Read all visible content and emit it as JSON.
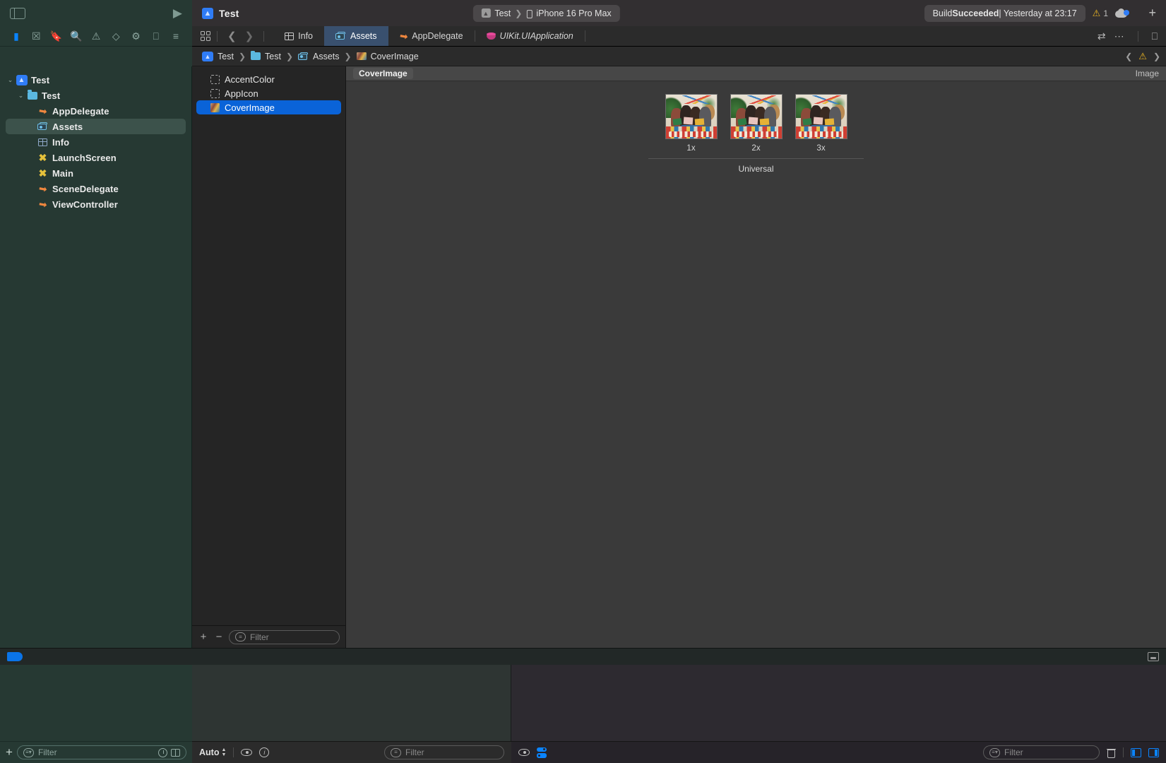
{
  "toolbar": {
    "sidebar_toggle_icon": "sidebar-toggle-icon",
    "run_icon": "play-icon",
    "project_name": "Test",
    "scheme": "Test",
    "destination": "iPhone 16 Pro Max",
    "build_status_prefix": "Build ",
    "build_status_strong": "Succeeded",
    "build_status_suffix": " | Yesterday at 23:17",
    "warning_count": "1",
    "add_icon": "plus-icon",
    "cloud_icon": "cloud-icon"
  },
  "navigator_icons": [
    {
      "name": "folder-icon",
      "glyph": "▮",
      "active": true
    },
    {
      "name": "source-control-icon",
      "glyph": "☒",
      "active": false
    },
    {
      "name": "bookmarks-icon",
      "glyph": "⚑",
      "active": false
    },
    {
      "name": "search-icon",
      "glyph": "⌕",
      "active": false
    },
    {
      "name": "issue-navigator-icon",
      "glyph": "⚠",
      "active": false
    },
    {
      "name": "test-navigator-icon",
      "glyph": "◇",
      "active": false
    },
    {
      "name": "debug-navigator-icon",
      "glyph": "☈",
      "active": false
    },
    {
      "name": "breakpoint-navigator-icon",
      "glyph": "⎕",
      "active": false
    },
    {
      "name": "report-navigator-icon",
      "glyph": "≡",
      "active": false
    }
  ],
  "tabbar": {
    "grid_icon": "grid-icon",
    "back_icon": "chevron-left-icon",
    "forward_icon": "chevron-right-icon",
    "tabs": [
      {
        "label": "Info",
        "icon": "plist-table-icon",
        "selected": false
      },
      {
        "label": "Assets",
        "icon": "assets-catalog-icon",
        "selected": true
      },
      {
        "label": "AppDelegate",
        "icon": "swift-file-icon",
        "selected": false
      },
      {
        "label": "UIKit.UIApplication",
        "icon": "uikit-framework-icon",
        "selected": false,
        "italic": true
      }
    ],
    "right_icons": [
      {
        "name": "swap-editors-icon",
        "glyph": "⇄"
      },
      {
        "name": "more-options-icon",
        "glyph": "⊙"
      },
      {
        "name": "add-editor-icon",
        "glyph": "⬚"
      }
    ]
  },
  "jumpbar": {
    "crumbs": [
      {
        "label": "Test",
        "icon": "project-icon"
      },
      {
        "label": "Test",
        "icon": "folder-icon"
      },
      {
        "label": "Assets",
        "icon": "assets-catalog-icon"
      },
      {
        "label": "CoverImage",
        "icon": "image-thumbnail-icon"
      }
    ],
    "separator": "❯",
    "prev_issue_icon": "chevron-left-icon",
    "warning_icon": "warning-triangle-icon",
    "next_issue_icon": "chevron-right-icon"
  },
  "project_tree": [
    {
      "label": "Test",
      "icon": "project-icon",
      "depth": 0,
      "twisty": "⌄",
      "selected": false
    },
    {
      "label": "Test",
      "icon": "folder-icon",
      "depth": 1,
      "twisty": "⌄",
      "selected": false
    },
    {
      "label": "AppDelegate",
      "icon": "swift-file-icon",
      "depth": 2,
      "twisty": "",
      "selected": false
    },
    {
      "label": "Assets",
      "icon": "assets-catalog-icon",
      "depth": 2,
      "twisty": "",
      "selected": true
    },
    {
      "label": "Info",
      "icon": "plist-file-icon",
      "depth": 2,
      "twisty": "",
      "selected": false
    },
    {
      "label": "LaunchScreen",
      "icon": "storyboard-icon",
      "depth": 2,
      "twisty": "",
      "selected": false
    },
    {
      "label": "Main",
      "icon": "storyboard-icon",
      "depth": 2,
      "twisty": "",
      "selected": false
    },
    {
      "label": "SceneDelegate",
      "icon": "swift-file-icon",
      "depth": 2,
      "twisty": "",
      "selected": false
    },
    {
      "label": "ViewController",
      "icon": "swift-file-icon",
      "depth": 2,
      "twisty": "",
      "selected": false
    }
  ],
  "navigator_bottom": {
    "add_icon": "plus-icon",
    "filter_placeholder": "Filter",
    "recent_icon": "recent-files-icon",
    "split_icon": "source-control-filter-icon"
  },
  "asset_list": {
    "items": [
      {
        "label": "AccentColor",
        "icon": "color-set-icon",
        "selected": false
      },
      {
        "label": "AppIcon",
        "icon": "app-icon-set-icon",
        "selected": false
      },
      {
        "label": "CoverImage",
        "icon": "image-set-icon",
        "selected": true
      }
    ],
    "add_icon": "plus-icon",
    "remove_icon": "minus-icon",
    "filter_placeholder": "Filter"
  },
  "editor": {
    "asset_name": "CoverImage",
    "kind_label": "Image",
    "slots": [
      {
        "caption": "1x"
      },
      {
        "caption": "2x"
      },
      {
        "caption": "3x"
      }
    ],
    "group_label": "Universal"
  },
  "debug_area": {
    "tag_icon": "blue-tag-icon",
    "console_toggle_icon": "console-panel-icon"
  },
  "status_bar": {
    "nav_add_icon": "plus-icon",
    "nav_filter_placeholder": "Filter",
    "nav_clock_icon": "recent-icon",
    "nav_split_icon": "split-icon",
    "auto_label": "Auto",
    "auto_stepper_icon": "stepper-icon",
    "eye_icon": "eye-icon",
    "info_icon": "info-icon",
    "variables_filter_placeholder": "Filter",
    "console_eye_icon": "eye-icon",
    "console_toggle_icon": "split-console-icon",
    "console_filter_placeholder": "Filter",
    "trash_icon": "trash-icon",
    "left_panel_icon": "left-panel-toggle-icon",
    "right_panel_icon": "right-panel-toggle-icon"
  },
  "colors": {
    "accent_blue": "#0a84ff",
    "selection_blue": "#0a63d8",
    "tab_selected": "#39506e",
    "navigator_bg": "#263933",
    "editor_bg": "#3a3a3a",
    "warning_yellow": "#e8b323"
  }
}
